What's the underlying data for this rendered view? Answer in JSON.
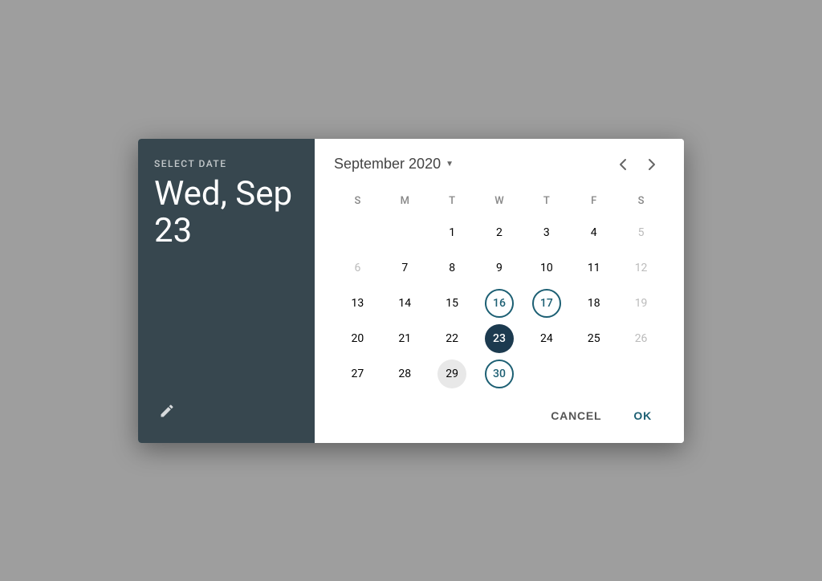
{
  "left": {
    "select_label": "SELECT DATE",
    "selected_day": "Wed, Sep",
    "selected_day2": "23",
    "edit_icon": "edit-icon"
  },
  "calendar": {
    "month_year": "September 2020",
    "prev_label": "‹",
    "next_label": "›",
    "day_headers": [
      "S",
      "M",
      "T",
      "W",
      "T",
      "F",
      "S"
    ],
    "weeks": [
      [
        {
          "num": "",
          "state": "empty"
        },
        {
          "num": "1",
          "state": "normal"
        },
        {
          "num": "2",
          "state": "normal"
        },
        {
          "num": "3",
          "state": "normal"
        },
        {
          "num": "4",
          "state": "normal"
        },
        {
          "num": "5",
          "state": "muted"
        }
      ],
      [
        {
          "num": "6",
          "state": "muted"
        },
        {
          "num": "7",
          "state": "normal"
        },
        {
          "num": "8",
          "state": "normal"
        },
        {
          "num": "9",
          "state": "normal"
        },
        {
          "num": "10",
          "state": "normal"
        },
        {
          "num": "11",
          "state": "normal"
        },
        {
          "num": "12",
          "state": "muted"
        }
      ],
      [
        {
          "num": "13",
          "state": "normal"
        },
        {
          "num": "14",
          "state": "normal"
        },
        {
          "num": "15",
          "state": "normal"
        },
        {
          "num": "16",
          "state": "circled-outline"
        },
        {
          "num": "17",
          "state": "circled-outline"
        },
        {
          "num": "18",
          "state": "normal"
        },
        {
          "num": "19",
          "state": "muted"
        }
      ],
      [
        {
          "num": "20",
          "state": "normal"
        },
        {
          "num": "21",
          "state": "normal"
        },
        {
          "num": "22",
          "state": "normal"
        },
        {
          "num": "23",
          "state": "selected"
        },
        {
          "num": "24",
          "state": "normal"
        },
        {
          "num": "25",
          "state": "normal"
        },
        {
          "num": "26",
          "state": "muted"
        }
      ],
      [
        {
          "num": "27",
          "state": "normal"
        },
        {
          "num": "28",
          "state": "normal"
        },
        {
          "num": "29",
          "state": "hovered"
        },
        {
          "num": "30",
          "state": "circled-outline"
        },
        {
          "num": "",
          "state": "empty"
        },
        {
          "num": "",
          "state": "empty"
        },
        {
          "num": "",
          "state": "empty"
        }
      ]
    ]
  },
  "actions": {
    "cancel": "CANCEL",
    "ok": "OK"
  }
}
